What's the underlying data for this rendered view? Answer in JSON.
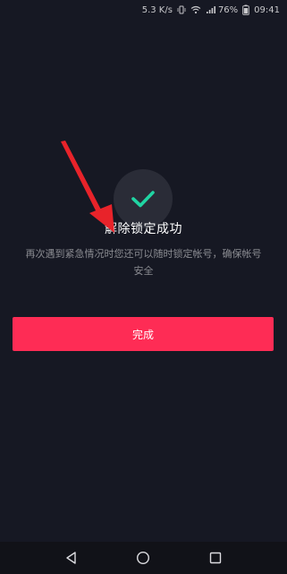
{
  "status_bar": {
    "network_speed": "5.3 K/s",
    "battery": "76%",
    "time": "09:41"
  },
  "main": {
    "title": "解除锁定成功",
    "description": "再次遇到紧急情况时您还可以随时锁定帐号，确保帐号安全",
    "done_label": "完成"
  },
  "colors": {
    "background": "#161823",
    "accent": "#fe2c55",
    "success": "#20d5a3"
  },
  "icons": {
    "status": [
      "vibrate-icon",
      "wifi-icon",
      "signal-icon",
      "battery-icon"
    ],
    "check": "check-icon",
    "nav": [
      "back-icon",
      "home-icon",
      "recents-icon"
    ]
  }
}
